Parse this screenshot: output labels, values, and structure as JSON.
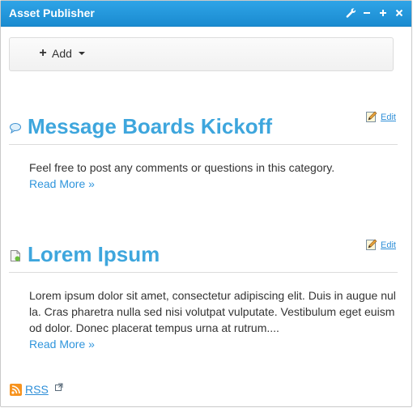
{
  "portlet": {
    "title": "Asset Publisher",
    "controls": [
      "wrench-icon",
      "minimize-icon",
      "maximize-icon",
      "close-icon"
    ]
  },
  "toolbar": {
    "add_label": "Add"
  },
  "assets": [
    {
      "icon": "message-bubble-icon",
      "title": "Message Boards Kickoff",
      "edit_label": "Edit",
      "summary": "Feel free to post any comments or questions in this category.",
      "read_more": "Read More »"
    },
    {
      "icon": "document-icon",
      "title": "Lorem Ipsum",
      "edit_label": "Edit",
      "summary": "Lorem ipsum dolor sit amet, consectetur adipiscing elit. Duis in augue nulla. Cras pharetra nulla sed nisi volutpat vulputate. Vestibulum eget euismod dolor. Donec placerat tempus urna at rutrum....",
      "read_more": "Read More »"
    }
  ],
  "footer": {
    "rss_label": "RSS"
  },
  "colors": {
    "header": "#1f95db",
    "title": "#3ea6dd",
    "link": "#2f8fd8"
  }
}
